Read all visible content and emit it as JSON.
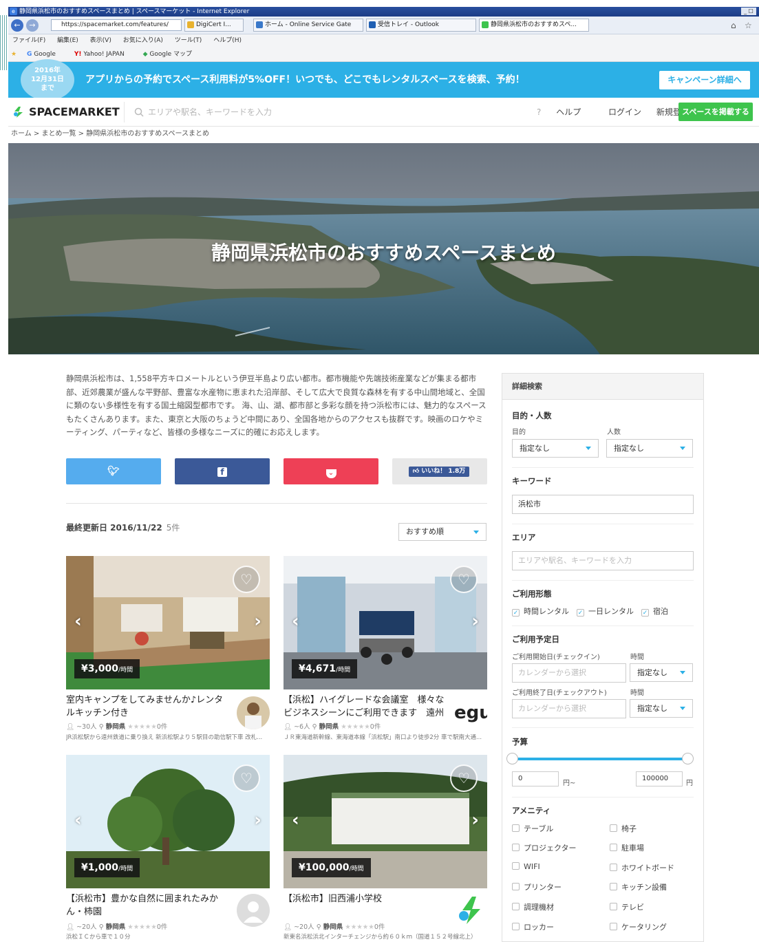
{
  "browser": {
    "window_title": "静岡県浜松市のおすすめスペースまとめ | スペースマーケット - Internet Explorer",
    "address": "https://spacemarket.com/features/",
    "cert": "DigiCert I...",
    "tabs": [
      {
        "label": "ホーム - Online Service Gate"
      },
      {
        "label": "受信トレイ - Outlook"
      },
      {
        "label": "静岡県浜松市のおすすめスペ..."
      }
    ],
    "menu": [
      "ファイル(F)",
      "編集(E)",
      "表示(V)",
      "お気に入り(A)",
      "ツール(T)",
      "ヘルプ(H)"
    ],
    "favorites": [
      "Google",
      "Yahoo! JAPAN",
      "Google マップ"
    ]
  },
  "banner": {
    "badge_line1": "2016年",
    "badge_line2": "12月31日",
    "badge_line3": "まで",
    "text": "アプリからの予約でスペース利用料が5%OFF！いつでも、どこでもレンタルスペースを検索、予約！",
    "cta": "キャンペーン詳細へ"
  },
  "header": {
    "logo": "SPACEMARKET",
    "search_placeholder": "エリアや駅名、キーワードを入力",
    "help": "ヘルプ",
    "login": "ログイン",
    "signup": "新規登録",
    "list_space": "スペースを掲載する"
  },
  "breadcrumb": [
    "ホーム",
    "まとめ一覧",
    "静岡県浜松市のおすすめスペースまとめ"
  ],
  "hero": {
    "title": "静岡県浜松市のおすすめスペースまとめ"
  },
  "intro": "静岡県浜松市は、1,558平方キロメートルという伊豆半島より広い都市。都市機能や先端技術産業などが集まる都市部、近郊農業が盛んな平野部、豊富な水産物に恵まれた沿岸部、そして広大で良質な森林を有する中山間地域と、全国に類のない多様性を有する国土縮図型都市です。 海、山、湖、都市部と多彩な顔を持つ浜松市には、魅力的なスペースもたくさんあります。また、東京と大阪のちょうど中間にあり、全国各地からのアクセスも抜群です。映画のロケやミーティング、パーティなど、皆様の多様なニーズに的確にお応えします。",
  "share": {
    "twitter_icon": "twitter-icon",
    "facebook_icon": "facebook-icon",
    "pocket_icon": "pocket-icon",
    "like": "いいね！ 1.8万"
  },
  "listing": {
    "updated_label": "最終更新日 2016/11/22",
    "count": "5件",
    "sort": "おすすめ順"
  },
  "cards": [
    {
      "price": "¥3,000",
      "unit": "/時間",
      "title": "室内キャンプをしてみませんか♪レンタルキッチン付き",
      "capacity": "~30人",
      "pref": "静岡県",
      "stars": "★★★★★",
      "reviews": "0件",
      "desc": "JR浜松駅から遠州鉄道に乗り換え 新浜松駅より５駅目の助信駅下車 改札..."
    },
    {
      "price": "¥4,671",
      "unit": "/時間",
      "title": "【浜松】ハイグレードな会議室　様々なビジネスシーンにご利用できます　遠州",
      "capacity": "~6人",
      "pref": "静岡県",
      "stars": "★★★★★",
      "reviews": "0件",
      "desc": "ＪＲ東海道新幹線、東海道本線「浜松駅」南口より徒歩2分 車で駅南大通...",
      "host_logo": "egu"
    },
    {
      "price": "¥1,000",
      "unit": "/時間",
      "title": "【浜松市】豊かな自然に囲まれたみかん・柿園",
      "capacity": "~20人",
      "pref": "静岡県",
      "stars": "★★★★★",
      "reviews": "0件",
      "desc": "浜松ＩＣから車で１０分"
    },
    {
      "price": "¥100,000",
      "unit": "/時間",
      "title": "【浜松市】旧西浦小学校",
      "capacity": "~20人",
      "pref": "静岡県",
      "stars": "★★★★★",
      "reviews": "0件",
      "desc": "新東名浜松浜北インターチェンジから約６０ｋｍ（国道１５２号線北上）"
    }
  ],
  "sidebar": {
    "title": "詳細検索",
    "purpose_heading": "目的・人数",
    "purpose_label": "目的",
    "purpose_value": "指定なし",
    "people_label": "人数",
    "people_value": "指定なし",
    "keyword_heading": "キーワード",
    "keyword_value": "浜松市",
    "area_heading": "エリア",
    "area_placeholder": "エリアや駅名、キーワードを入力",
    "usage_heading": "ご利用形態",
    "usage_options": [
      "時間レンタル",
      "一日レンタル",
      "宿泊"
    ],
    "date_heading": "ご利用予定日",
    "checkin_label": "ご利用開始日(チェックイン)",
    "checkout_label": "ご利用終了日(チェックアウト)",
    "time_label": "時間",
    "calendar_placeholder": "カレンダーから選択",
    "time_value": "指定なし",
    "budget_heading": "予算",
    "budget_min": "0",
    "budget_max": "100000",
    "yen_from": "円~",
    "yen": "円",
    "amenity_heading": "アメニティ",
    "amenities_left": [
      "テーブル",
      "プロジェクター",
      "WIFI",
      "プリンター",
      "調理機材",
      "ロッカー"
    ],
    "amenities_right": [
      "椅子",
      "駐車場",
      "ホワイトボード",
      "キッチン設備",
      "テレビ",
      "ケータリング"
    ]
  },
  "colors": {
    "brand_blue": "#2cb0e6",
    "brand_green": "#3ec44d",
    "twitter": "#55acee",
    "facebook": "#3b5998",
    "pocket": "#ee4056"
  }
}
